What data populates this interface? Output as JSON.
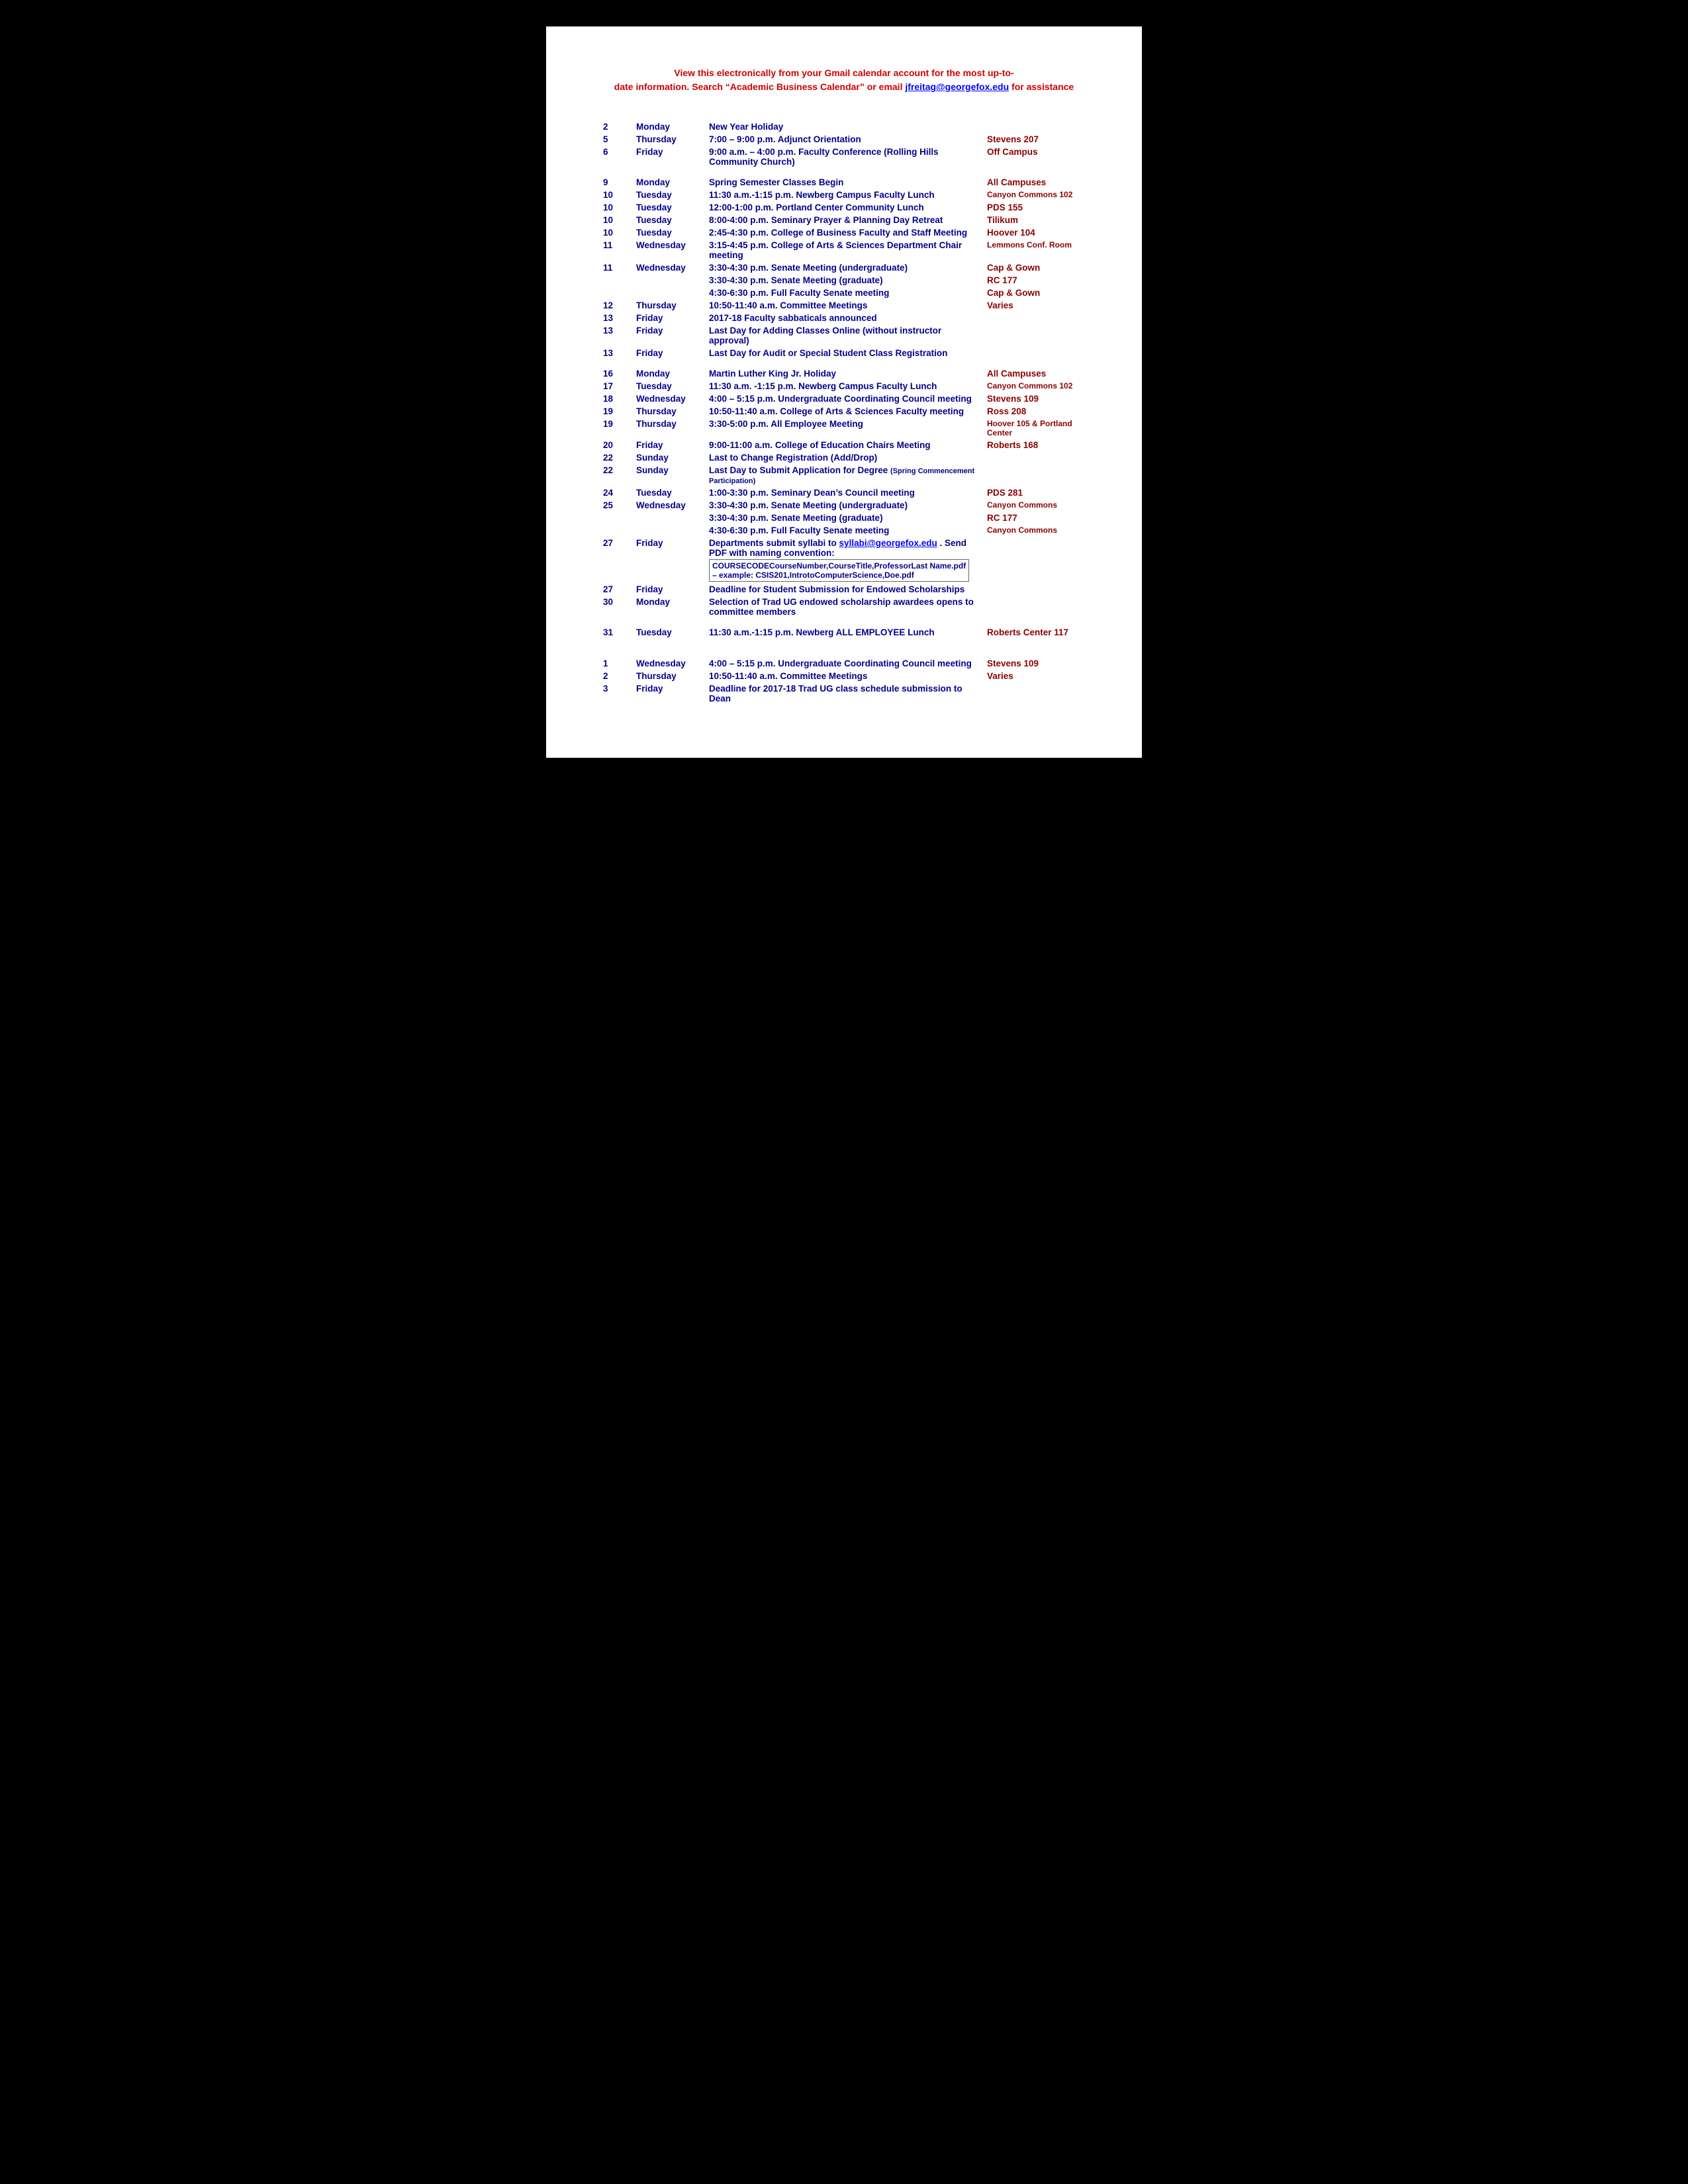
{
  "header": {
    "line1": "View this electronically from your Gmail calendar account for the most up-to-",
    "line2": "date information. Search “Academic Business Calendar” or email",
    "email": "jfreitag@georgefox.edu",
    "line3": " for assistance"
  },
  "events": [
    {
      "day": "2",
      "weekday": "Monday",
      "event": "New Year Holiday",
      "location": "",
      "locationSize": "large",
      "spacer": false
    },
    {
      "day": "5",
      "weekday": "Thursday",
      "event": "7:00 – 9:00 p.m. Adjunct Orientation",
      "location": "Stevens 207",
      "locationSize": "large",
      "spacer": false
    },
    {
      "day": "6",
      "weekday": "Friday",
      "event": "9:00 a.m. – 4:00 p.m. Faculty Conference (Rolling Hills Community Church)",
      "location": "Off Campus",
      "locationSize": "large",
      "spacer": false
    },
    {
      "day": "9",
      "weekday": "Monday",
      "event": "Spring Semester Classes Begin",
      "location": "All Campuses",
      "locationSize": "large",
      "spacer": true
    },
    {
      "day": "10",
      "weekday": "Tuesday",
      "event": "11:30 a.m.-1:15 p.m. Newberg Campus Faculty Lunch",
      "location": "Canyon Commons 102",
      "locationSize": "small",
      "spacer": false
    },
    {
      "day": "10",
      "weekday": "Tuesday",
      "event": "12:00-1:00 p.m. Portland Center Community Lunch",
      "location": "PDS 155",
      "locationSize": "large",
      "spacer": false
    },
    {
      "day": "10",
      "weekday": "Tuesday",
      "event": "8:00-4:00 p.m. Seminary Prayer & Planning Day Retreat",
      "location": "Tilikum",
      "locationSize": "large",
      "spacer": false
    },
    {
      "day": "10",
      "weekday": "Tuesday",
      "event": "2:45-4:30 p.m. College of Business Faculty and Staff Meeting",
      "location": "Hoover 104",
      "locationSize": "large",
      "spacer": false
    },
    {
      "day": "11",
      "weekday": "Wednesday",
      "event": "3:15-4:45 p.m. College of Arts & Sciences Department Chair meeting",
      "location": "Lemmons Conf. Room",
      "locationSize": "small",
      "spacer": false
    },
    {
      "day": "11",
      "weekday": "Wednesday",
      "event": "3:30-4:30 p.m. Senate Meeting (undergraduate)",
      "location": "Cap & Gown",
      "locationSize": "large",
      "spacer": false
    },
    {
      "day": "",
      "weekday": "",
      "event": "3:30-4:30 p.m. Senate Meeting (graduate)",
      "location": "RC 177",
      "locationSize": "large",
      "spacer": false,
      "continuation": true
    },
    {
      "day": "",
      "weekday": "",
      "event": "4:30-6:30 p.m. Full Faculty Senate meeting",
      "location": "Cap & Gown",
      "locationSize": "large",
      "spacer": false,
      "continuation": true
    },
    {
      "day": "12",
      "weekday": "Thursday",
      "event": "10:50-11:40 a.m. Committee Meetings",
      "location": "Varies",
      "locationSize": "large",
      "spacer": false
    },
    {
      "day": "13",
      "weekday": "Friday",
      "event": "2017-18 Faculty sabbaticals announced",
      "location": "",
      "locationSize": "large",
      "spacer": false
    },
    {
      "day": "13",
      "weekday": "Friday",
      "event": "Last Day for Adding Classes Online (without instructor approval)",
      "location": "",
      "locationSize": "large",
      "spacer": false
    },
    {
      "day": "13",
      "weekday": "Friday",
      "event": "Last Day for Audit or Special Student Class Registration",
      "location": "",
      "locationSize": "large",
      "spacer": false
    },
    {
      "day": "16",
      "weekday": "Monday",
      "event": "Martin Luther King Jr. Holiday",
      "location": "All Campuses",
      "locationSize": "large",
      "spacer": true
    },
    {
      "day": "17",
      "weekday": "Tuesday",
      "event": "11:30 a.m. -1:15 p.m. Newberg Campus Faculty Lunch",
      "location": "Canyon Commons 102",
      "locationSize": "small",
      "spacer": false
    },
    {
      "day": "18",
      "weekday": "Wednesday",
      "event": "4:00 – 5:15 p.m. Undergraduate Coordinating Council meeting",
      "location": "Stevens 109",
      "locationSize": "large",
      "spacer": false
    },
    {
      "day": "19",
      "weekday": "Thursday",
      "event": "10:50-11:40 a.m. College of Arts & Sciences Faculty meeting",
      "location": "Ross 208",
      "locationSize": "large",
      "spacer": false
    },
    {
      "day": "19",
      "weekday": "Thursday",
      "event": "3:30-5:00 p.m. All Employee Meeting",
      "location": "Hoover 105 & Portland Center",
      "locationSize": "small",
      "spacer": false
    },
    {
      "day": "20",
      "weekday": "Friday",
      "event": "9:00-11:00 a.m. College of Education Chairs Meeting",
      "location": "Roberts 168",
      "locationSize": "large",
      "spacer": false
    },
    {
      "day": "22",
      "weekday": "Sunday",
      "event": "Last to Change Registration (Add/Drop)",
      "location": "",
      "locationSize": "large",
      "spacer": false
    },
    {
      "day": "22",
      "weekday": "Sunday",
      "event": "Last Day to Submit Application for Degree (Spring Commencement Participation)",
      "location": "",
      "locationSize": "large",
      "spacer": false,
      "smallEvent": true
    },
    {
      "day": "24",
      "weekday": "Tuesday",
      "event": "1:00-3:30 p.m. Seminary Dean’s Council meeting",
      "location": "PDS 281",
      "locationSize": "large",
      "spacer": false
    },
    {
      "day": "25",
      "weekday": "Wednesday",
      "event": "3:30-4:30 p.m. Senate Meeting (undergraduate)",
      "location": "Canyon Commons",
      "locationSize": "small",
      "spacer": false
    },
    {
      "day": "",
      "weekday": "",
      "event": "3:30-4:30 p.m. Senate Meeting (graduate)",
      "location": "RC 177",
      "locationSize": "large",
      "spacer": false,
      "continuation": true
    },
    {
      "day": "",
      "weekday": "",
      "event": "4:30-6:30 p.m. Full Faculty Senate meeting",
      "location": "Canyon Commons",
      "locationSize": "small",
      "spacer": false,
      "continuation": true
    },
    {
      "day": "27",
      "weekday": "Friday",
      "event": "Departments submit syllabi to syllabi@georgefox.edu . Send PDF with naming convention:",
      "location": "",
      "locationSize": "large",
      "spacer": false,
      "hasLink": true,
      "linkText": "syllabi@georgefox.edu",
      "namingConvention": "COURSECODECourseNumber,CourseTitle,ProfessorLast Name.pdf\n– example: CSIS201,IntrotoComputerScience,Doe.pdf"
    },
    {
      "day": "27",
      "weekday": "Friday",
      "event": "Deadline for Student Submission for Endowed Scholarships",
      "location": "",
      "locationSize": "large",
      "spacer": false
    },
    {
      "day": "30",
      "weekday": "Monday",
      "event": "Selection of Trad UG endowed scholarship awardees opens to committee members",
      "location": "",
      "locationSize": "large",
      "spacer": false
    },
    {
      "day": "31",
      "weekday": "Tuesday",
      "event": "11:30 a.m.-1:15 p.m. Newberg ALL EMPLOYEE Lunch",
      "location": "Roberts Center 117",
      "locationSize": "large",
      "spacer": true
    },
    {
      "day": "1",
      "weekday": "Wednesday",
      "event": "4:00 – 5:15 p.m. Undergraduate Coordinating Council meeting",
      "location": "Stevens 109",
      "locationSize": "large",
      "spacer": true,
      "sectionGap": true
    },
    {
      "day": "2",
      "weekday": "Thursday",
      "event": "10:50-11:40 a.m. Committee Meetings",
      "location": "Varies",
      "locationSize": "large",
      "spacer": false
    },
    {
      "day": "3",
      "weekday": "Friday",
      "event": "Deadline for 2017-18 Trad UG class schedule submission to Dean",
      "location": "",
      "locationSize": "large",
      "spacer": false
    }
  ]
}
